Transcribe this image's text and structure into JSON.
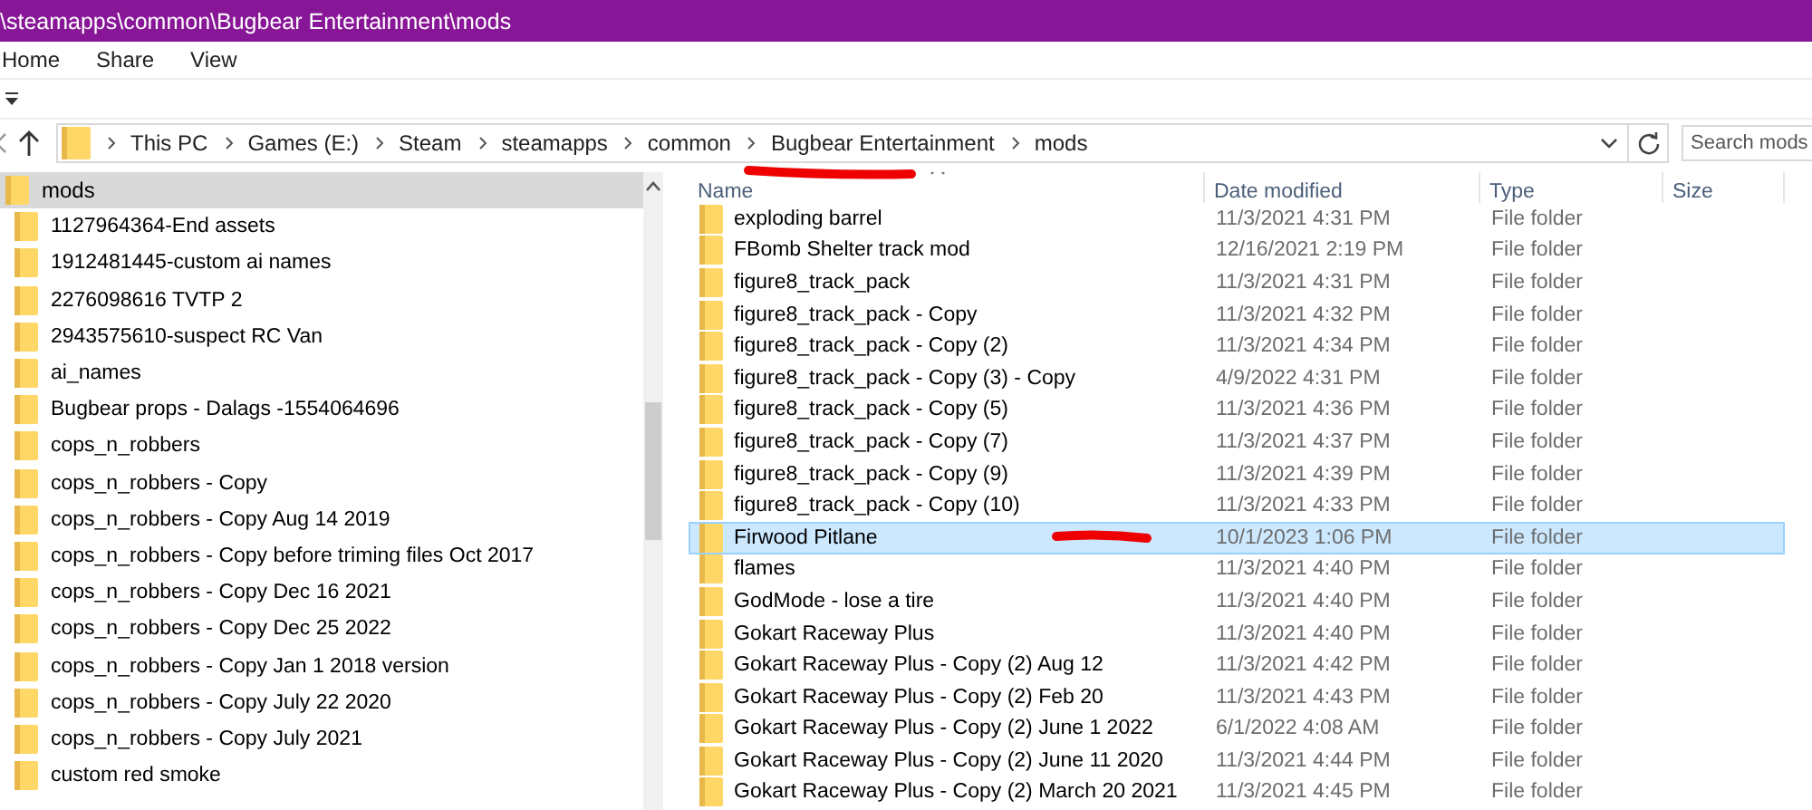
{
  "window": {
    "title": "\\steamapps\\common\\Bugbear Entertainment\\mods"
  },
  "ribbon_tabs": [
    {
      "label": "Home"
    },
    {
      "label": "Share"
    },
    {
      "label": "View"
    }
  ],
  "address_bar": {
    "path": [
      "This PC",
      "Games (E:)",
      "Steam",
      "steamapps",
      "common",
      "Bugbear Entertainment",
      "mods"
    ]
  },
  "search": {
    "placeholder": "Search mods"
  },
  "navigation_pane": {
    "items": [
      {
        "label": "mods",
        "selected": true,
        "children": [
          {
            "label": "1127964364-End assets",
            "selected": false
          },
          {
            "label": "1912481445-custom ai names",
            "selected": false
          },
          {
            "label": "2276098616 TVTP 2",
            "selected": false
          },
          {
            "label": "2943575610-suspect RC Van",
            "selected": false
          },
          {
            "label": "ai_names",
            "selected": false
          },
          {
            "label": "Bugbear props - Dalags -1554064696",
            "selected": false
          },
          {
            "label": "cops_n_robbers",
            "selected": false
          },
          {
            "label": "cops_n_robbers - Copy",
            "selected": false
          },
          {
            "label": "cops_n_robbers - Copy Aug 14 2019",
            "selected": false
          },
          {
            "label": "cops_n_robbers - Copy before triming files Oct 2017",
            "selected": false
          },
          {
            "label": "cops_n_robbers - Copy Dec 16 2021",
            "selected": false
          },
          {
            "label": "cops_n_robbers - Copy Dec 25 2022",
            "selected": false
          },
          {
            "label": "cops_n_robbers - Copy Jan 1 2018 version",
            "selected": false
          },
          {
            "label": "cops_n_robbers - Copy July 22  2020",
            "selected": false
          },
          {
            "label": "cops_n_robbers - Copy July 2021",
            "selected": false
          },
          {
            "label": "custom red smoke",
            "selected": false
          }
        ]
      }
    ]
  },
  "file_list": {
    "columns": [
      {
        "label": "Name",
        "sorted": true
      },
      {
        "label": "Date modified",
        "sorted": false
      },
      {
        "label": "Type",
        "sorted": false
      },
      {
        "label": "Size",
        "sorted": false
      }
    ],
    "rows": [
      {
        "name": "exploding barrel",
        "date_modified": "11/3/2021 4:31 PM",
        "type": "File folder",
        "selected": false
      },
      {
        "name": "FBomb Shelter track mod",
        "date_modified": "12/16/2021 2:19 PM",
        "type": "File folder",
        "selected": false
      },
      {
        "name": "figure8_track_pack",
        "date_modified": "11/3/2021 4:31 PM",
        "type": "File folder",
        "selected": false
      },
      {
        "name": "figure8_track_pack - Copy",
        "date_modified": "11/3/2021 4:32 PM",
        "type": "File folder",
        "selected": false
      },
      {
        "name": "figure8_track_pack - Copy (2)",
        "date_modified": "11/3/2021 4:34 PM",
        "type": "File folder",
        "selected": false
      },
      {
        "name": "figure8_track_pack - Copy (3) - Copy",
        "date_modified": "4/9/2022 4:31 PM",
        "type": "File folder",
        "selected": false
      },
      {
        "name": "figure8_track_pack - Copy (5)",
        "date_modified": "11/3/2021 4:36 PM",
        "type": "File folder",
        "selected": false
      },
      {
        "name": "figure8_track_pack - Copy (7)",
        "date_modified": "11/3/2021 4:37 PM",
        "type": "File folder",
        "selected": false
      },
      {
        "name": "figure8_track_pack - Copy (9)",
        "date_modified": "11/3/2021 4:39 PM",
        "type": "File folder",
        "selected": false
      },
      {
        "name": "figure8_track_pack - Copy (10)",
        "date_modified": "11/3/2021 4:33 PM",
        "type": "File folder",
        "selected": false
      },
      {
        "name": "Firwood Pitlane",
        "date_modified": "10/1/2023 1:06 PM",
        "type": "File folder",
        "selected": true
      },
      {
        "name": "flames",
        "date_modified": "11/3/2021 4:40 PM",
        "type": "File folder",
        "selected": false
      },
      {
        "name": "GodMode - lose a tire",
        "date_modified": "11/3/2021 4:40 PM",
        "type": "File folder",
        "selected": false
      },
      {
        "name": "Gokart Raceway Plus",
        "date_modified": "11/3/2021 4:40 PM",
        "type": "File folder",
        "selected": false
      },
      {
        "name": "Gokart Raceway Plus - Copy (2) Aug 12",
        "date_modified": "11/3/2021 4:42 PM",
        "type": "File folder",
        "selected": false
      },
      {
        "name": "Gokart Raceway Plus - Copy (2) Feb 20",
        "date_modified": "11/3/2021 4:43 PM",
        "type": "File folder",
        "selected": false
      },
      {
        "name": "Gokart Raceway Plus - Copy (2) June 1 2022",
        "date_modified": "6/1/2022 4:08 AM",
        "type": "File folder",
        "selected": false
      },
      {
        "name": "Gokart Raceway Plus - Copy (2) June 11 2020",
        "date_modified": "11/3/2021 4:44 PM",
        "type": "File folder",
        "selected": false
      },
      {
        "name": "Gokart Raceway Plus - Copy (2) March 20 2021",
        "date_modified": "11/3/2021 4:45 PM",
        "type": "File folder",
        "selected": false
      }
    ]
  }
}
